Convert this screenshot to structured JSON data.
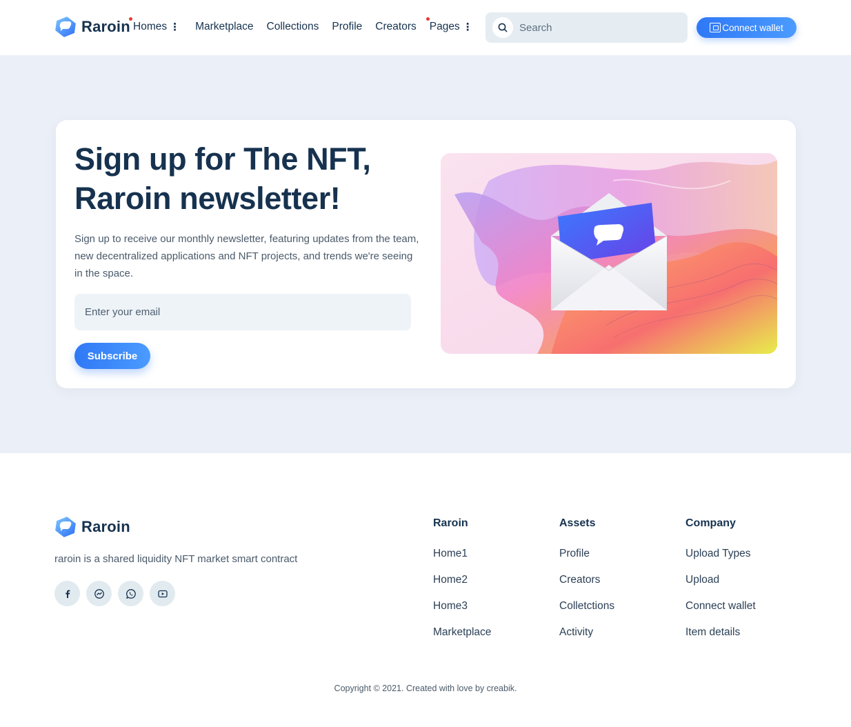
{
  "header": {
    "brand": "Raroin",
    "nav": [
      {
        "label": "Homes",
        "has_menu": true,
        "has_dot": true
      },
      {
        "label": "Marketplace",
        "has_menu": false,
        "has_dot": false
      },
      {
        "label": "Collections",
        "has_menu": false,
        "has_dot": false
      },
      {
        "label": "Profile",
        "has_menu": false,
        "has_dot": false
      },
      {
        "label": "Creators",
        "has_menu": false,
        "has_dot": false
      },
      {
        "label": "Pages",
        "has_menu": true,
        "has_dot": true
      }
    ],
    "search_placeholder": "Search",
    "connect_label": "Connect wallet"
  },
  "newsletter": {
    "title": "Sign up for The NFT, Raroin newsletter!",
    "description": "Sign up to receive our monthly newsletter, featuring updates from the team, new decentralized applications and NFT projects, and trends we're seeing in the space.",
    "email_placeholder": "Enter your email",
    "subscribe_label": "Subscribe"
  },
  "footer": {
    "brand": "Raroin",
    "description": "raroin is a shared liquidity NFT market smart contract",
    "socials": [
      "facebook-icon",
      "messenger-icon",
      "whatsapp-icon",
      "youtube-icon"
    ],
    "columns": [
      {
        "title": "Raroin",
        "links": [
          "Home1",
          "Home2",
          "Home3",
          "Marketplace"
        ]
      },
      {
        "title": "Assets",
        "links": [
          "Profile",
          "Creators",
          "Colletctions",
          "Activity"
        ]
      },
      {
        "title": "Company",
        "links": [
          "Upload Types",
          "Upload",
          "Connect wallet",
          "Item details"
        ]
      }
    ],
    "copyright": "Copyright © 2021. Created with love by creabik."
  },
  "colors": {
    "accent": "#2f78f5",
    "dark_text": "#16324f",
    "band_background": "#ebeff7",
    "notification_dot": "#e53935"
  }
}
